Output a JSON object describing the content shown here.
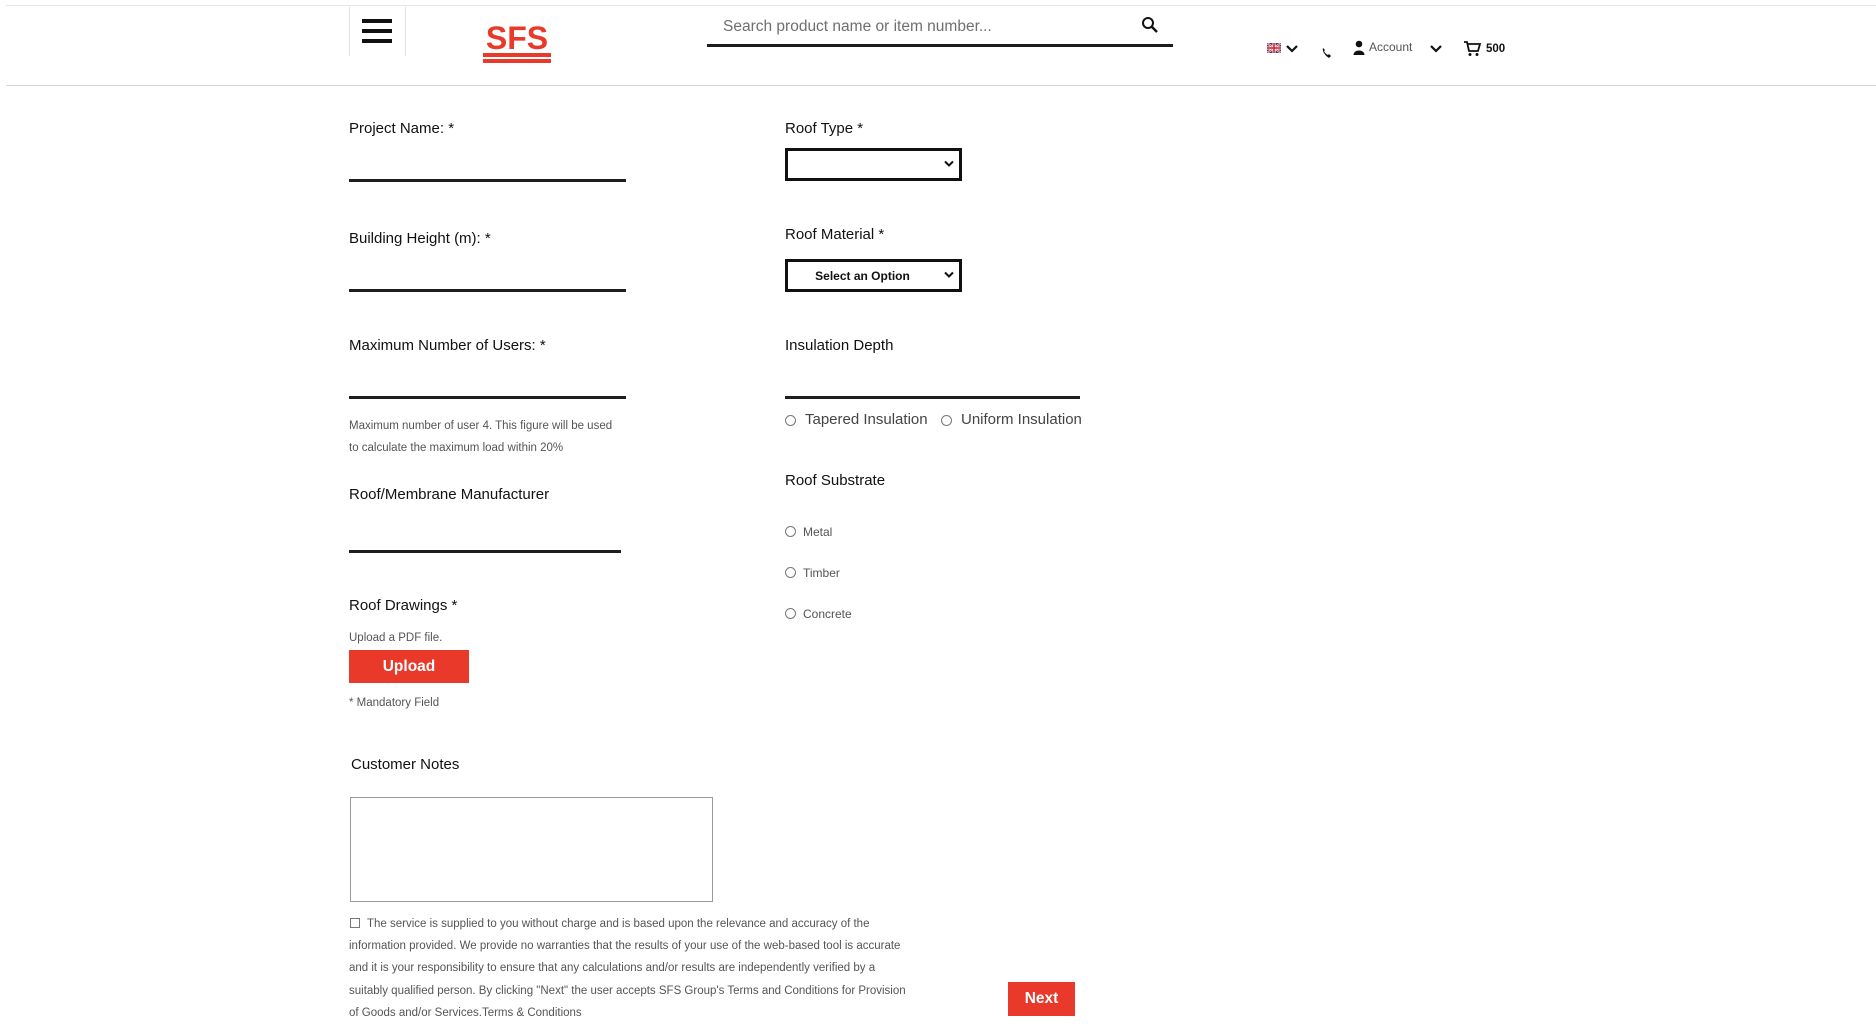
{
  "header": {
    "logo_text": "SFS",
    "search_placeholder": "Search product name or item number...",
    "account_label": "Account",
    "cart_count": "500"
  },
  "form": {
    "project_name_label": "Project Name: *",
    "building_height_label": "Building Height (m): *",
    "max_users_label": "Maximum Number of Users: *",
    "max_users_help_1": "Maximum number of user 4. This figure will be used",
    "max_users_help_2": "to calculate the maximum load within 20%",
    "manufacturer_label": "Roof/Membrane Manufacturer",
    "drawings_label": "Roof Drawings *",
    "drawings_help": "Upload a PDF file.",
    "upload_button": "Upload",
    "mandatory_note": "* Mandatory Field",
    "roof_type_label": "Roof Type *",
    "roof_type_value": "",
    "roof_material_label": "Roof Material *",
    "roof_material_value": "Select an Option",
    "insulation_depth_label": "Insulation Depth",
    "insulation_options": [
      "Tapered Insulation",
      "Uniform Insulation"
    ],
    "roof_substrate_label": "Roof Substrate",
    "substrate_options": [
      "Metal",
      "Timber",
      "Concrete"
    ],
    "customer_notes_label": "Customer Notes",
    "disclaimer_lines": [
      "The service is supplied to you without charge and is based upon the relevance and accuracy of the",
      "information provided. We provide no warranties that the results of your use of the web-based tool is accurate",
      "and it is your responsibility to ensure that any calculations and/or results are independently verified by a",
      "suitably qualified person. By clicking \"Next\" the user accepts SFS Group's Terms and Conditions for Provision",
      "of Goods and/or Services.Terms & Conditions"
    ],
    "next_button": "Next"
  },
  "colors": {
    "brand_red": "#e8392b",
    "text": "#111111"
  }
}
